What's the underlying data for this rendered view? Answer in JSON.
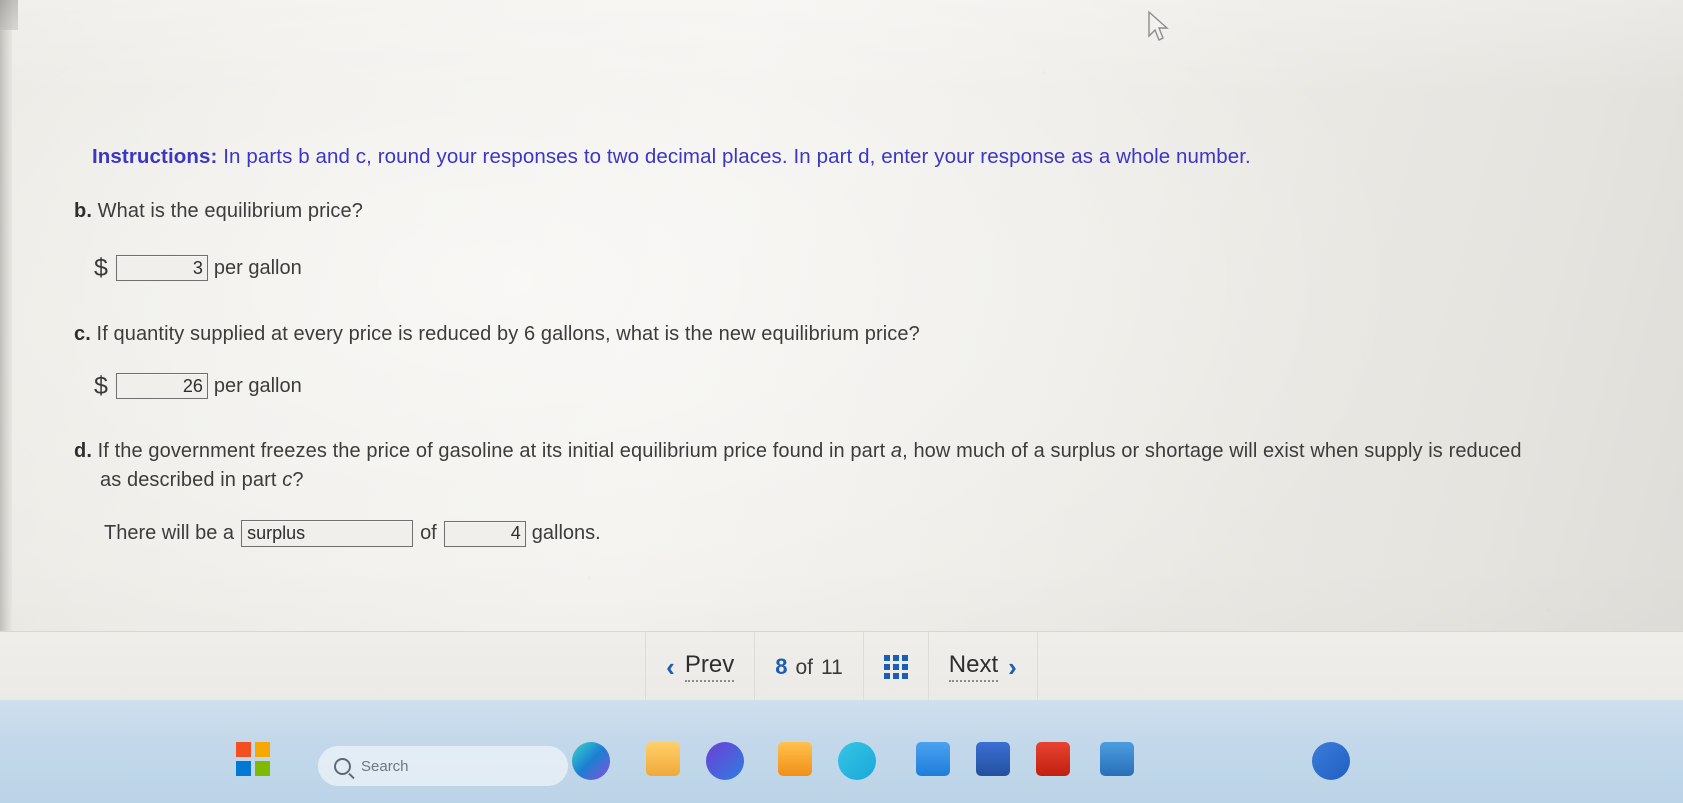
{
  "page": {
    "instructions_label": "Instructions:",
    "instructions_text": " In parts b and c, round your responses to two decimal places. In part d, enter your response as a whole number."
  },
  "questions": {
    "b": {
      "label": "b.",
      "text": " What is the equilibrium price?",
      "currency_symbol": "$",
      "answer_value": "3",
      "unit": "per gallon"
    },
    "c": {
      "label": "c.",
      "text": " If quantity supplied at every price is reduced by 6 gallons, what is the new equilibrium price?",
      "currency_symbol": "$",
      "answer_value": "26",
      "unit": "per gallon"
    },
    "d": {
      "label": "d.",
      "text_part1": " If the government freezes the price of gasoline at its initial equilibrium price found in part ",
      "text_italic1": "a",
      "text_part2": ", how much of a surplus or shortage will exist when supply is reduced as described in part ",
      "text_italic2": "c",
      "text_part3": "?",
      "prefix": "There will be a",
      "select_value": "surplus",
      "select_options": [
        "surplus",
        "shortage"
      ],
      "middle": "of",
      "answer_value": "4",
      "unit": "gallons."
    }
  },
  "nav": {
    "prev_label": "Prev",
    "current_page": "8",
    "of_label": "of",
    "total_pages": "11",
    "grid_icon": "grid-icon",
    "next_label": "Next",
    "prev_icon": "chevron-left-icon",
    "next_icon": "chevron-right-icon"
  },
  "taskbar": {
    "search_placeholder": "Search",
    "search_icon": "search-icon",
    "icons": [
      "windows-start-icon",
      "copilot-icon",
      "file-explorer-icon",
      "edge-browser-icon",
      "store-icon",
      "mail-icon",
      "chrome-browser-icon",
      "teams-icon",
      "word-icon",
      "excel-icon"
    ]
  },
  "colors": {
    "instructions": "#3b36c4",
    "body_text": "#3c3c3c",
    "accent_blue": "#1b5fb5",
    "page_bg": "#eeece7",
    "taskbar_bg": "#c3d8ea"
  },
  "cursor": {
    "icon": "mouse-pointer-icon"
  }
}
